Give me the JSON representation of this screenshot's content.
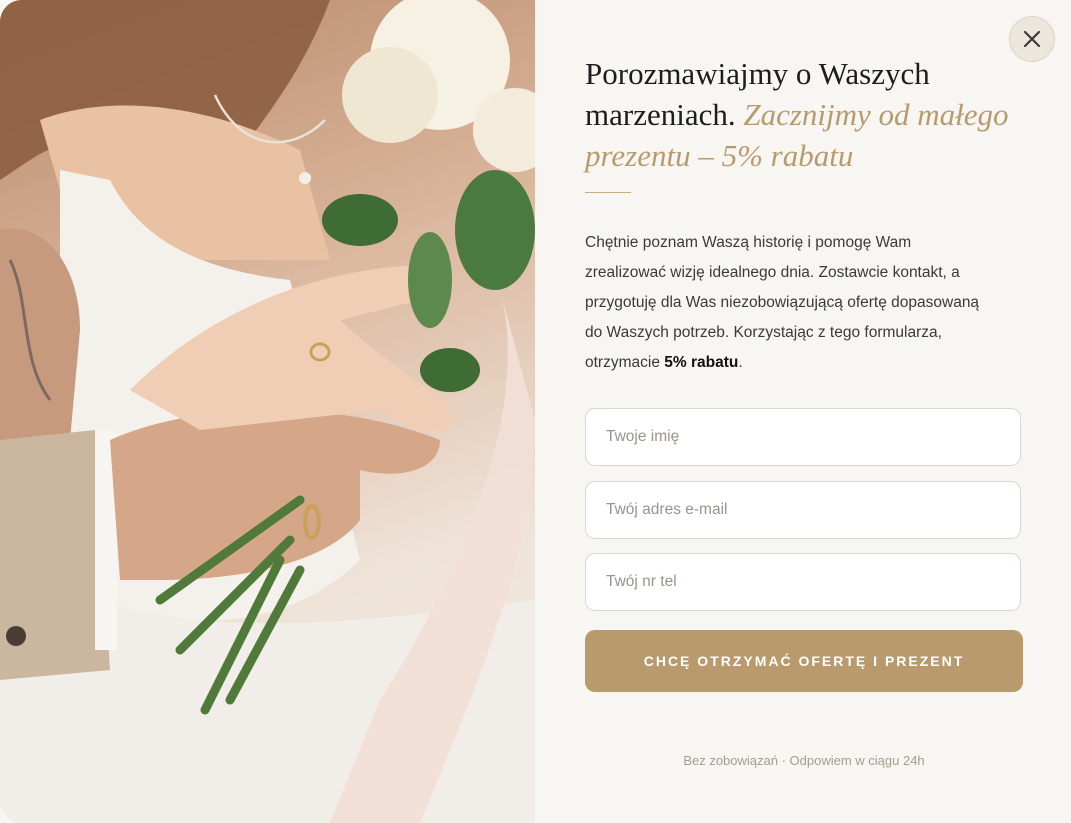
{
  "photo": {
    "alt_icon": "wedding-photo"
  },
  "close": {
    "icon": "close-icon"
  },
  "heading": {
    "main": "Porozmawiajmy o Waszych marzeniach.",
    "accent": "Zacznijmy od małego prezentu – 5% rabatu"
  },
  "intro": {
    "text": "Chętnie poznam Waszą historię i pomogę Wam zrealizować wizję idealnego dnia. Zostawcie kontakt, a przygotuję dla Was niezobowiązującą ofertę dopasowaną do Waszych potrzeb. Korzystając z tego formularza, otrzymacie ",
    "highlight": "5% rabatu",
    "end": "."
  },
  "form": {
    "name_placeholder": "Twoje imię",
    "email_placeholder": "Twój adres e-mail",
    "phone_placeholder": "Twój nr tel",
    "submit_label": "CHCĘ OTRZYMAĆ OFERTĘ I PREZENT"
  },
  "footnote": "Bez zobowiązań · Odpowiem w ciągu 24h",
  "colors": {
    "accent": "#b99a6c",
    "background": "#f8f6f2",
    "text": "#1d1d1d"
  }
}
